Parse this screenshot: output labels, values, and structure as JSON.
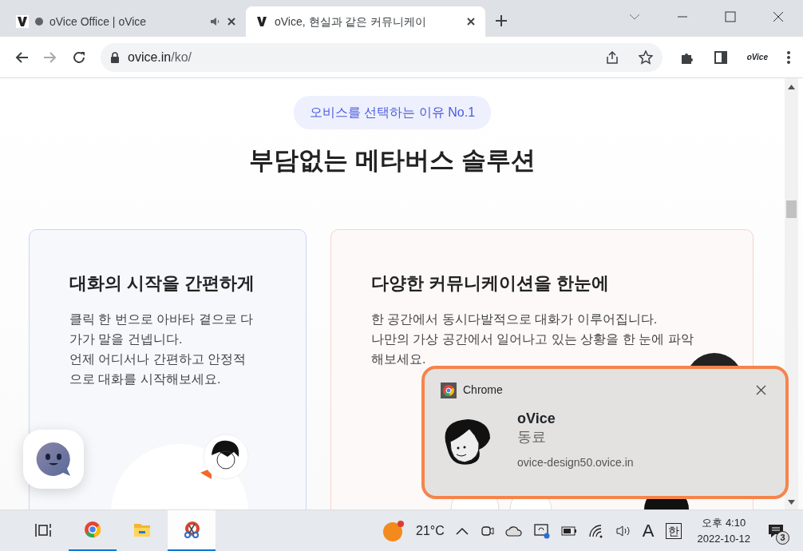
{
  "browser": {
    "tabs": [
      {
        "title": "oVice Office | oVice",
        "selected": false,
        "audio": true
      },
      {
        "title": "oVice, 현실과 같은 커뮤니케이",
        "selected": true,
        "audio": false
      }
    ],
    "address": {
      "host": "ovice.in",
      "path": "/ko/"
    },
    "extension_label": "oVice"
  },
  "page": {
    "badge": "오비스를 선택하는 이유 No.1",
    "heading": "부담없는 메타버스 솔루션",
    "cards": [
      {
        "title": "대화의 시작을 간편하게",
        "paragraphs": [
          "클릭 한 번으로 아바타 곁으로 다가가 말을 건넵니다.",
          "언제 어디서나 간편하고 안정적으로 대화를 시작해보세요."
        ],
        "color": "#c9d6fb"
      },
      {
        "title": "다양한 커뮤니케이션을 한눈에",
        "paragraphs": [
          "한 공간에서 동시다발적으로 대화가 이루어집니다.",
          "나만의 가상 공간에서 일어나고 있는 상황을 한 눈에 파악해보세요."
        ],
        "color": "#f8d3c9"
      }
    ]
  },
  "notification": {
    "app": "Chrome",
    "title": "oVice",
    "body": "동료",
    "source": "ovice-design50.ovice.in"
  },
  "taskbar": {
    "apps": [
      {
        "kind": "taskview",
        "running": false,
        "selected": false
      },
      {
        "kind": "chrome",
        "running": true,
        "selected": false
      },
      {
        "kind": "explorer",
        "running": false,
        "selected": false
      },
      {
        "kind": "snip",
        "running": true,
        "selected": true
      }
    ],
    "weather": "21°C",
    "input_mode": "A",
    "ime": "한",
    "time": "오후 4:10",
    "date": "2022-10-12",
    "notification_count": "3"
  }
}
